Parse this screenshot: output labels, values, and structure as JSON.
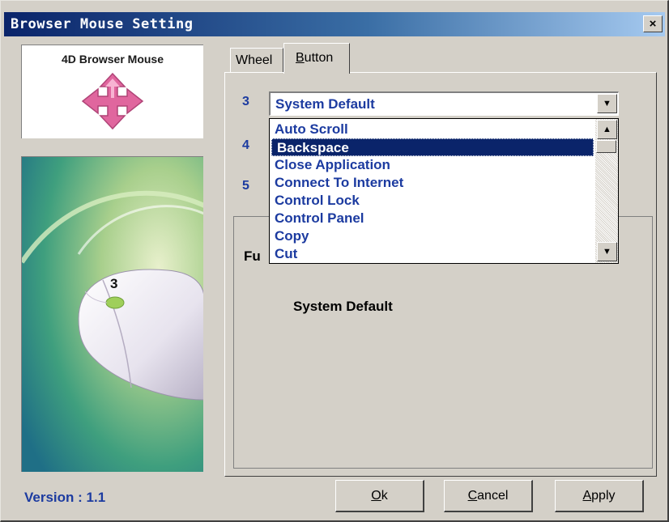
{
  "window": {
    "title": "Browser Mouse Setting",
    "close_glyph": "×"
  },
  "logo": {
    "text": "4D Browser Mouse",
    "icon": "four-way-arrow-icon",
    "color": "#e0669e"
  },
  "illustration": {
    "button_number": "3"
  },
  "version_label": "Version : 1.1",
  "tabs": [
    {
      "label": "Wheel",
      "active": false
    },
    {
      "label": "Button",
      "mnemonic": "B",
      "rest": "utton",
      "active": true
    }
  ],
  "button_rows": [
    {
      "number": "3"
    },
    {
      "number": "4"
    },
    {
      "number": "5"
    }
  ],
  "combo": {
    "selected": "System Default"
  },
  "dropdown": {
    "items": [
      "Auto Scroll",
      "Backspace",
      "Close Application",
      "Connect To Internet",
      "Control Lock",
      "Control Panel",
      "Copy",
      "Cut"
    ],
    "highlighted_index": 1
  },
  "function": {
    "label_visible": "Fu",
    "value": "System Default"
  },
  "buttons": {
    "ok": {
      "mnemonic": "O",
      "rest": "k"
    },
    "cancel": {
      "mnemonic": "C",
      "rest": "ancel"
    },
    "apply": {
      "mnemonic": "A",
      "rest": "pply"
    }
  },
  "colors": {
    "title_start": "#0a246a",
    "title_end": "#a6caf0",
    "text_blue": "#1c3ba0",
    "face": "#d4d0c8",
    "selection": "#0a246a"
  }
}
